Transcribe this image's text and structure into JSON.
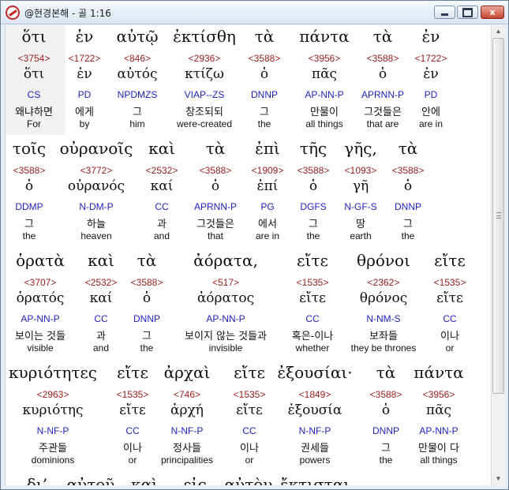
{
  "window": {
    "title": "@현경본해 - 골 1:16",
    "minimize_icon": "minimize-icon",
    "maximize_icon": "maximize-icon",
    "close_label": "x"
  },
  "lines": [
    {
      "words": [
        {
          "greek": "ὅτι",
          "strong": "<3754>",
          "lemma": "ὅτι",
          "parse": "CS",
          "korean": "왜냐하면",
          "english": "For"
        },
        {
          "greek": "ἐν",
          "strong": "<1722>",
          "lemma": "ἐν",
          "parse": "PD",
          "korean": "에게",
          "english": "by"
        },
        {
          "greek": "αὐτῷ",
          "strong": "<846>",
          "lemma": "αὐτός",
          "parse": "NPDMZS",
          "korean": "그",
          "english": "him"
        },
        {
          "greek": "ἐκτίσθη",
          "strong": "<2936>",
          "lemma": "κτίζω",
          "parse": "VIAP--ZS",
          "korean": "창조되되",
          "english": "were-created"
        },
        {
          "greek": "τὰ",
          "strong": "<3588>",
          "lemma": "ὁ",
          "parse": "DNNP",
          "korean": "그",
          "english": "the"
        },
        {
          "greek": "πάντα",
          "strong": "<3956>",
          "lemma": "πᾶς",
          "parse": "AP-NN-P",
          "korean": "만물이",
          "english": "all things"
        },
        {
          "greek": "τὰ",
          "strong": "<3588>",
          "lemma": "ὁ",
          "parse": "APRNN-P",
          "korean": "그것들은",
          "english": "that are"
        },
        {
          "greek": "ἐν",
          "strong": "<1722>",
          "lemma": "ἐν",
          "parse": "PD",
          "korean": "안에",
          "english": "are in"
        }
      ]
    },
    {
      "words": [
        {
          "greek": "τοῖς",
          "strong": "<3588>",
          "lemma": "ὁ",
          "parse": "DDMP",
          "korean": "그",
          "english": "the"
        },
        {
          "greek": "οὐρανοῖς",
          "strong": "<3772>",
          "lemma": "οὐρανός",
          "parse": "N-DM-P",
          "korean": "하늘",
          "english": "heaven"
        },
        {
          "greek": "καὶ",
          "strong": "<2532>",
          "lemma": "καί",
          "parse": "CC",
          "korean": "과",
          "english": "and"
        },
        {
          "greek": "τὰ",
          "strong": "<3588>",
          "lemma": "ὁ",
          "parse": "APRNN-P",
          "korean": "그것들은",
          "english": "that"
        },
        {
          "greek": "ἐπὶ",
          "strong": "<1909>",
          "lemma": "ἐπί",
          "parse": "PG",
          "korean": "에서",
          "english": "are in"
        },
        {
          "greek": "τῆς",
          "strong": "<3588>",
          "lemma": "ὁ",
          "parse": "DGFS",
          "korean": "그",
          "english": "the"
        },
        {
          "greek": "γῆς,",
          "strong": "<1093>",
          "lemma": "γῆ",
          "parse": "N-GF-S",
          "korean": "땅",
          "english": "earth"
        },
        {
          "greek": "τὰ",
          "strong": "<3588>",
          "lemma": "ὁ",
          "parse": "DNNP",
          "korean": "그",
          "english": "the"
        }
      ]
    },
    {
      "words": [
        {
          "greek": "ὁρατὰ",
          "strong": "<3707>",
          "lemma": "ὁρατός",
          "parse": "AP-NN-P",
          "korean": "보이는 것들",
          "english": "visible"
        },
        {
          "greek": "καὶ",
          "strong": "<2532>",
          "lemma": "καί",
          "parse": "CC",
          "korean": "과",
          "english": "and"
        },
        {
          "greek": "τὰ",
          "strong": "<3588>",
          "lemma": "ὁ",
          "parse": "DNNP",
          "korean": "그",
          "english": "the"
        },
        {
          "greek": "ἀόρατα,",
          "strong": "<517>",
          "lemma": "ἀόρατος",
          "parse": "AP-NN-P",
          "korean": "보이지 않는 것들과",
          "english": "invisible"
        },
        {
          "greek": "εἴτε",
          "strong": "<1535>",
          "lemma": "εἴτε",
          "parse": "CC",
          "korean": "혹은-이나",
          "english": "whether"
        },
        {
          "greek": "θρόνοι",
          "strong": "<2362>",
          "lemma": "θρόνος",
          "parse": "N-NM-S",
          "korean": "보좌들",
          "english": "they be thrones"
        },
        {
          "greek": "εἴτε",
          "strong": "<1535>",
          "lemma": "εἴτε",
          "parse": "CC",
          "korean": "이나",
          "english": "or"
        }
      ]
    },
    {
      "words": [
        {
          "greek": "κυριότητες",
          "strong": "<2963>",
          "lemma": "κυριότης",
          "parse": "N-NF-P",
          "korean": "주관들",
          "english": "dominions"
        },
        {
          "greek": "εἴτε",
          "strong": "<1535>",
          "lemma": "εἴτε",
          "parse": "CC",
          "korean": "이나",
          "english": "or"
        },
        {
          "greek": "ἀρχαὶ",
          "strong": "<746>",
          "lemma": "ἀρχή",
          "parse": "N-NF-P",
          "korean": "정사들",
          "english": "principalities"
        },
        {
          "greek": "εἴτε",
          "strong": "<1535>",
          "lemma": "εἴτε",
          "parse": "CC",
          "korean": "이나",
          "english": "or"
        },
        {
          "greek": "ἐξουσίαι·",
          "strong": "<1849>",
          "lemma": "ἐξουσία",
          "parse": "N-NF-P",
          "korean": "권세들",
          "english": "powers"
        },
        {
          "greek": "τὰ",
          "strong": "<3588>",
          "lemma": "ὁ",
          "parse": "DNNP",
          "korean": "그",
          "english": "the"
        },
        {
          "greek": "πάντα",
          "strong": "<3956>",
          "lemma": "πᾶς",
          "parse": "AP-NN-P",
          "korean": "만물이 다",
          "english": "all things"
        }
      ]
    },
    {
      "words": [
        {
          "greek": "δι’",
          "strong": "",
          "lemma": "",
          "parse": "",
          "korean": "",
          "english": ""
        },
        {
          "greek": "αὐτοῦ",
          "strong": "",
          "lemma": "",
          "parse": "",
          "korean": "",
          "english": ""
        },
        {
          "greek": "καὶ",
          "strong": "",
          "lemma": "",
          "parse": "",
          "korean": "",
          "english": ""
        },
        {
          "greek": "εἰς",
          "strong": "",
          "lemma": "",
          "parse": "",
          "korean": "",
          "english": ""
        },
        {
          "greek": "αὐτὸν",
          "strong": "",
          "lemma": "",
          "parse": "",
          "korean": "",
          "english": ""
        },
        {
          "greek": "ἔκτισται",
          "strong": "",
          "lemma": "",
          "parse": "",
          "korean": "",
          "english": ""
        }
      ]
    }
  ],
  "colors": {
    "strong": "#9b1c1c",
    "parse": "#1f1fbf",
    "text": "#111111",
    "highlight": "#f1f1f1"
  }
}
